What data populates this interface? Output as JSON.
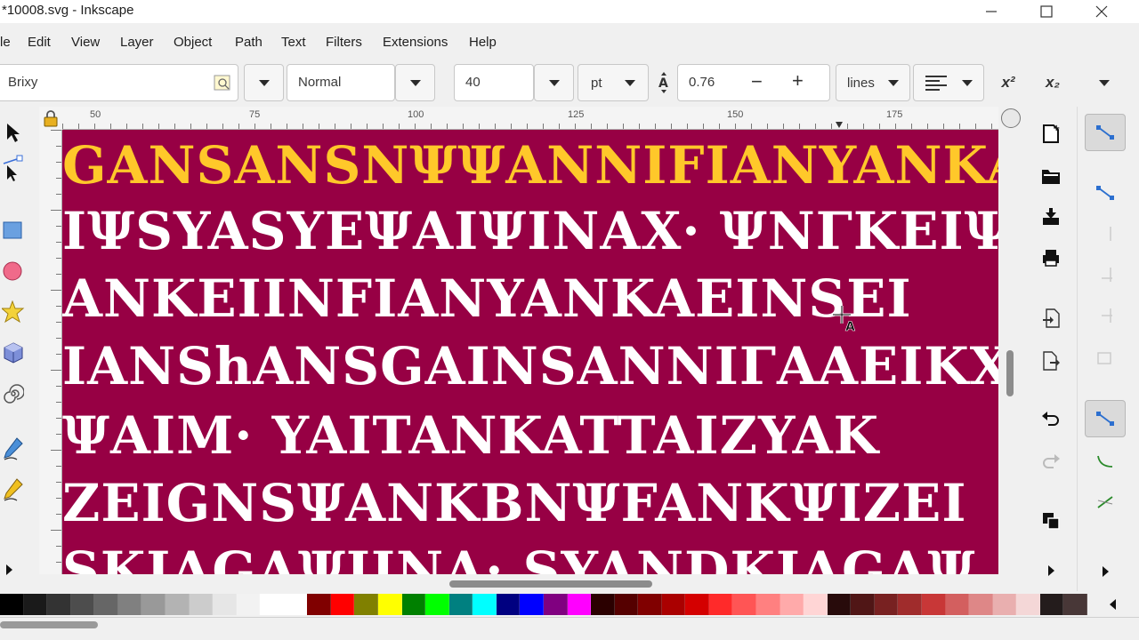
{
  "window": {
    "title": "*10008.svg - Inkscape",
    "minimize_label": "—",
    "maximize_label": "☐",
    "close_label": "✕"
  },
  "menu": {
    "items": [
      "le",
      "Edit",
      "View",
      "Layer",
      "Object",
      "Path",
      "Text",
      "Filters",
      "Extensions",
      "Help"
    ]
  },
  "text_toolbar": {
    "font_family": "Brixy",
    "font_style": "Normal",
    "font_size": "40",
    "unit": "pt",
    "line_spacing": "0.76",
    "minus_label": "−",
    "plus_label": "+",
    "spacing_mode": "lines",
    "superscript_label": "x²",
    "subscript_label": "x₂"
  },
  "ruler": {
    "labels": [
      "50",
      "75",
      "100",
      "125",
      "150",
      "175"
    ]
  },
  "canvas": {
    "background_color": "#970044",
    "lines": [
      {
        "text": "GANSANSNΨΨANNIFIANYANKA",
        "color": "#ffc82a"
      },
      {
        "text": "IΨSYASYEΨAIΨINAX·  ΨNΓKEIΨ",
        "color": "#ffffff"
      },
      {
        "text": "ANKEIINFIANYANKAEINSEI",
        "color": "#ffffff"
      },
      {
        "text": "IANShANSGAINSANNIΓAAEIKXΨ",
        "color": "#ffffff"
      },
      {
        "text": "ΨAIM·  YAITANKATTAIZYAK",
        "color": "#ffffff"
      },
      {
        "text": "ZEIGNSΨANKBNΨFANKΨIZEI",
        "color": "#ffffff"
      },
      {
        "text": "SKIAGAΨIINA·  SYANDKIAGAΨ",
        "color": "#ffffff"
      }
    ]
  },
  "palette": {
    "colors": [
      "#000000",
      "#1a1a1a",
      "#333333",
      "#4d4d4d",
      "#666666",
      "#808080",
      "#999999",
      "#b3b3b3",
      "#cccccc",
      "#e6e6e6",
      "#f2f2f2",
      "#ffffff",
      "#ffffff",
      "#800000",
      "#ff0000",
      "#808000",
      "#ffff00",
      "#008000",
      "#00ff00",
      "#008080",
      "#00ffff",
      "#000080",
      "#0000ff",
      "#800080",
      "#ff00ff",
      "#2b0000",
      "#550000",
      "#800000",
      "#aa0000",
      "#d40000",
      "#ff2a2a",
      "#ff5555",
      "#ff8080",
      "#ffaaaa",
      "#ffd5d5",
      "#280b0b",
      "#501616",
      "#782121",
      "#a02c2c",
      "#c83737",
      "#d35f5f",
      "#de8787",
      "#e9afaf",
      "#f4d7d7",
      "#241c1c",
      "#483737"
    ]
  }
}
